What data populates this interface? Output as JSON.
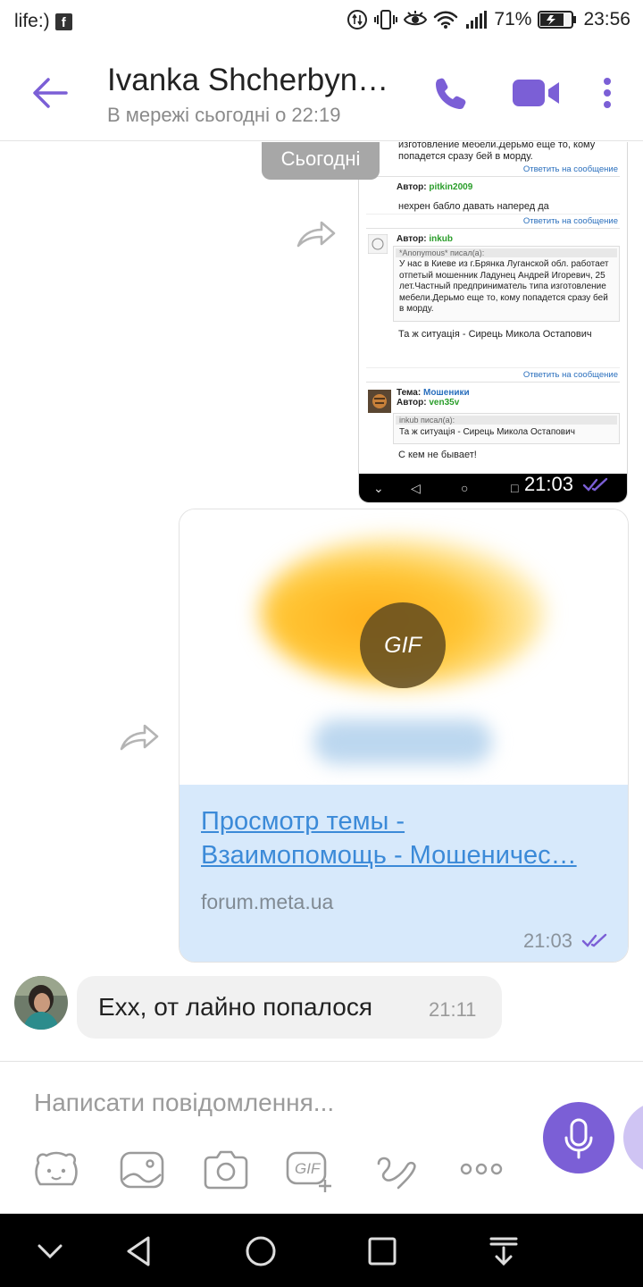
{
  "status_bar": {
    "carrier": "life:)",
    "fb_glyph": "f",
    "battery_percent": "71%",
    "time": "23:56",
    "icons": [
      "facebook-icon",
      "lte-icon",
      "vibrate-icon",
      "eye-icon",
      "wifi-icon",
      "signal-icon",
      "battery-charging-icon"
    ]
  },
  "header": {
    "name": "Ivanka Shcherbyna…",
    "status": "В мережі сьогодні о 22:19"
  },
  "chat": {
    "date_chip": "Сьогодні",
    "screenshot_msg": {
      "time": "21:03",
      "posts": [
        {
          "text": "изготовление мебели.Дерьмо еще то, кому попадется сразу бей в морду.",
          "reply": "Ответить на сообщение"
        },
        {
          "author_label": "Автор:",
          "author": "pitkin2009",
          "text": "нехрен бабло давать наперед да",
          "reply": "Ответить на сообщение"
        },
        {
          "author_label": "Автор:",
          "author": "inkub",
          "quote_head": "*Anonymous* писал(а):",
          "quote": "У нас в Киеве из г.Брянка Луганской обл. работает отпетый мошенник Ладунец Андрей Игоревич, 25 лет.Частный предприниматель типа изготовление мебели.Дерьмо еще то, кому попадется сразу бей в морду.",
          "text": "Та ж ситуація - Сирець Микола Остапович",
          "reply": "Ответить на сообщение"
        },
        {
          "topic_label": "Тема:",
          "topic": "Мошеники",
          "author_label": "Автор:",
          "author": "ven35v",
          "quote_head": "inkub писал(а):",
          "quote": "Та ж ситуація - Сирець Микола Остапович",
          "text": "С кем не бывает!"
        }
      ]
    },
    "link_msg": {
      "gif_label": "GIF",
      "title_line1": "Просмотр темы -",
      "title_line2": "Взаимопомощь - Мошеничес…",
      "domain": "forum.meta.ua",
      "time": "21:03"
    },
    "incoming_msg": {
      "text": "Ехх, от лайно попалося",
      "time": "21:11"
    }
  },
  "composer": {
    "placeholder": "Написати повідомлення...",
    "gif_label": "GIF",
    "toolbar_icons": [
      "sticker-icon",
      "gallery-icon",
      "camera-icon",
      "gif-icon",
      "doodle-icon",
      "more-icon"
    ]
  },
  "colors": {
    "accent": "#7b5fd6",
    "link": "#3b8ad8",
    "link_bubble_bg": "#d7e9fb",
    "incoming_bubble_bg": "#f1f1f1"
  }
}
